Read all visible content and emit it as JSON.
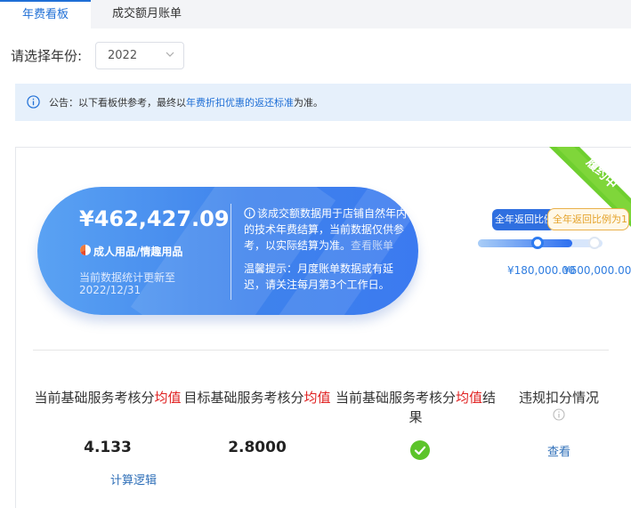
{
  "tabs": [
    {
      "label": "年费看板",
      "active": true
    },
    {
      "label": "成交额月账单",
      "active": false
    }
  ],
  "year_filter": {
    "label": "请选择年份:",
    "selected": "2022"
  },
  "notice": {
    "prefix": "公告：以下看板供参考，最终以",
    "link": "年费折扣优惠的返还标准",
    "suffix": "为准。"
  },
  "status_ribbon": "履约中",
  "summary_card": {
    "amount": "¥462,427.09",
    "category": "成人用品/情趣用品",
    "updated_line1": "当前数据统计更新至",
    "updated_line2": "2022/12/31",
    "note": "该成交额数据用于店铺自然年内的技术年费结算，当前数据仅供参考，以实际结算为准。",
    "note_link": "查看账单",
    "tip": "温馨提示：月度账单数据或有延迟，请关注每月第3个工作日。"
  },
  "threshold_slider": {
    "tag_reached": "全年返回比例",
    "tag_next": "全年返回比例为1",
    "threshold_1": "¥180,000.00",
    "threshold_2": "¥600,000.00",
    "progress_fraction": 0.74
  },
  "metrics": [
    {
      "title_prefix": "当前基础服务考核分",
      "title_red": "均值",
      "title_suffix": "",
      "value": "4.133",
      "link": "计算逻辑"
    },
    {
      "title_prefix": "目标基础服务考核分",
      "title_red": "均值",
      "title_suffix": "",
      "value": "2.8000"
    },
    {
      "title_prefix": "当前基础服务考核分",
      "title_red": "均值",
      "title_suffix": "结果",
      "status_icon": "check-circle-icon"
    },
    {
      "title_prefix": "违规扣分情况",
      "title_red": "",
      "title_suffix": "",
      "link": "查看"
    }
  ],
  "colors": {
    "accent": "#1f6fd6",
    "card_blue": "#3f83ec",
    "ribbon_green": "#6fcf2f",
    "success_green": "#5cc42a",
    "highlight_red": "#e02020",
    "tag_orange": "#e4a22a"
  }
}
